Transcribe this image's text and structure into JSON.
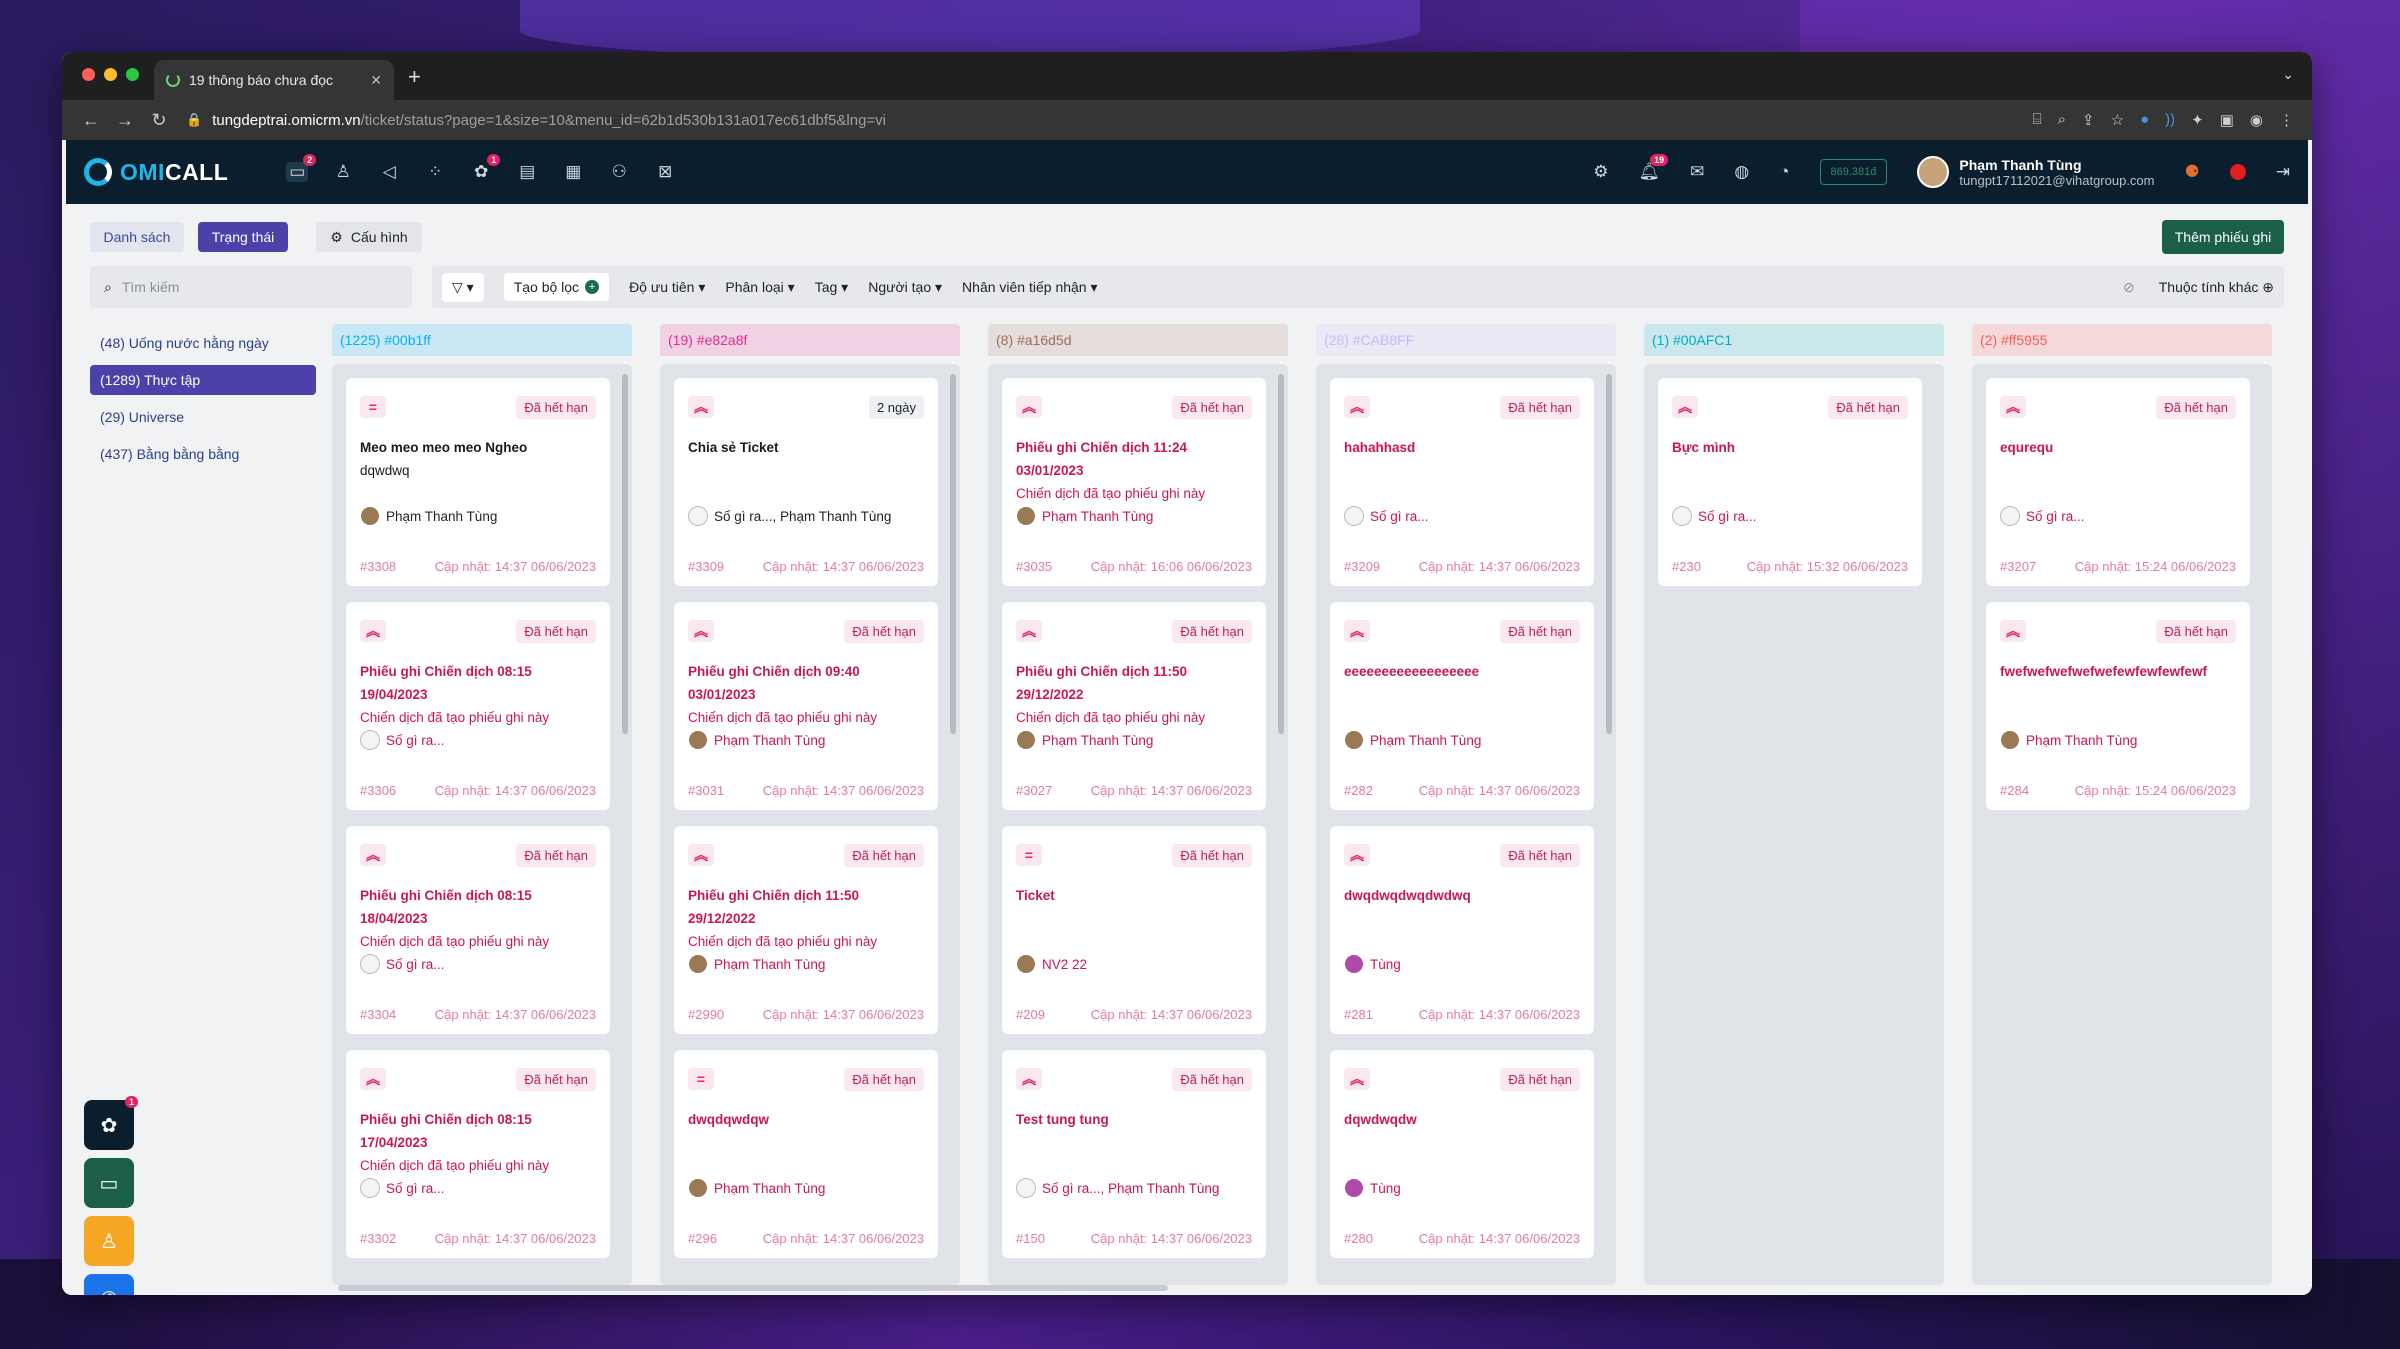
{
  "browser": {
    "tab_title": "19 thông báo chưa đọc",
    "url_host": "tungdeptrai.omicrm.vn",
    "url_path": "/ticket/status?page=1&size=10&menu_id=62b1d530b131a017ec61dbf5&lng=vi"
  },
  "nav": {
    "logo_omi": "OMI",
    "logo_call": "CALL",
    "badge_ticket": "2",
    "badge_support": "1",
    "badge_notify": "19",
    "balance": "869.381đ",
    "user_name": "Phạm Thanh Tùng",
    "user_email": "tungpt17112021@vihatgroup.com"
  },
  "toolbar": {
    "list_label": "Danh sách",
    "status_label": "Trạng thái",
    "config_label": "Cấu hình",
    "add_label": "Thêm phiếu ghi"
  },
  "filters": {
    "search_placeholder": "Tìm kiếm",
    "create_filter": "Tạo bộ lọc",
    "priority": "Độ ưu tiên",
    "category": "Phân loại",
    "tag": "Tag",
    "creator": "Người tạo",
    "assignee": "Nhân viên tiếp nhận",
    "other": "Thuộc tính khác"
  },
  "sidebar": [
    {
      "label": "(48)  Uống nước hằng ngày"
    },
    {
      "label": "(1289)  Thực tập"
    },
    {
      "label": "(29)  Universe"
    },
    {
      "label": "(437)  Bằng bằng bằng"
    }
  ],
  "columns": [
    {
      "head": "(1225) #00b1ff",
      "color": "#00b1ff",
      "cards": [
        {
          "icon": "=",
          "badge": "Đã hết hạn",
          "title": "Meo meo meo meo Ngheo",
          "sub": "dqwdwq",
          "dark": true,
          "assignee": "Phạm Thanh Tùng",
          "id": "#3308",
          "updated": "Cập nhật: 14:37 06/06/2023"
        },
        {
          "icon": "^",
          "badge": "Đã hết hạn",
          "title": "Phiếu ghi Chiến dịch 08:15 19/04/2023",
          "sub": "Chiến dịch đã tạo phiếu ghi này",
          "dark": false,
          "assignee": "Số gì ra...",
          "id": "#3306",
          "updated": "Cập nhật: 14:37 06/06/2023"
        },
        {
          "icon": "^",
          "badge": "Đã hết hạn",
          "title": "Phiếu ghi Chiến dịch 08:15 18/04/2023",
          "sub": "Chiến dịch đã tạo phiếu ghi này",
          "dark": false,
          "assignee": "Số gì ra...",
          "id": "#3304",
          "updated": "Cập nhật: 14:37 06/06/2023"
        },
        {
          "icon": "^",
          "badge": "Đã hết hạn",
          "title": "Phiếu ghi Chiến dịch 08:15 17/04/2023",
          "sub": "Chiến dịch đã tạo phiếu ghi này",
          "dark": false,
          "assignee": "Số gì ra...",
          "id": "#3302",
          "updated": "Cập nhật: 14:37 06/06/2023"
        }
      ]
    },
    {
      "head": "(19) #e82a8f",
      "color": "#e82a8f",
      "cards": [
        {
          "icon": "^",
          "badge": "2 ngày",
          "title": "Chia sẻ Ticket",
          "sub": "",
          "dark": true,
          "assignee": "Số gì ra..., Phạm Thanh Tùng",
          "id": "#3309",
          "updated": "Cập nhật: 14:37 06/06/2023"
        },
        {
          "icon": "^",
          "badge": "Đã hết hạn",
          "title": "Phiếu ghi Chiến dịch 09:40 03/01/2023",
          "sub": "Chiến dịch đã tạo phiếu ghi này",
          "dark": false,
          "assignee": "Phạm Thanh Tùng",
          "id": "#3031",
          "updated": "Cập nhật: 14:37 06/06/2023"
        },
        {
          "icon": "^",
          "badge": "Đã hết hạn",
          "title": "Phiếu ghi Chiến dịch 11:50 29/12/2022",
          "sub": "Chiến dịch đã tạo phiếu ghi này",
          "dark": false,
          "assignee": "Phạm Thanh Tùng",
          "id": "#2990",
          "updated": "Cập nhật: 14:37 06/06/2023"
        },
        {
          "icon": "=",
          "badge": "Đã hết hạn",
          "title": "dwqdqwdqw",
          "sub": "",
          "dark": false,
          "assignee": "Phạm Thanh Tùng",
          "id": "#296",
          "updated": "Cập nhật: 14:37 06/06/2023"
        }
      ]
    },
    {
      "head": "(8) #a16d5d",
      "color": "#a16d5d",
      "cards": [
        {
          "icon": "^",
          "badge": "Đã hết hạn",
          "title": "Phiếu ghi Chiến dịch 11:24 03/01/2023",
          "sub": "Chiến dịch đã tạo phiếu ghi này",
          "dark": false,
          "assignee": "Phạm Thanh Tùng",
          "id": "#3035",
          "updated": "Cập nhật: 16:06 06/06/2023"
        },
        {
          "icon": "^",
          "badge": "Đã hết hạn",
          "title": "Phiếu ghi Chiến dịch 11:50 29/12/2022",
          "sub": "Chiến dịch đã tạo phiếu ghi này",
          "dark": false,
          "assignee": "Phạm Thanh Tùng",
          "id": "#3027",
          "updated": "Cập nhật: 14:37 06/06/2023"
        },
        {
          "icon": "=",
          "badge": "Đã hết hạn",
          "title": "Ticket",
          "sub": "",
          "dark": false,
          "assignee": "NV2 22",
          "id": "#209",
          "updated": "Cập nhật: 14:37 06/06/2023"
        },
        {
          "icon": "^",
          "badge": "Đã hết hạn",
          "title": "Test tung tung",
          "sub": "",
          "dark": false,
          "assignee": "Số gì ra..., Phạm Thanh Tùng",
          "id": "#150",
          "updated": "Cập nhật: 14:37 06/06/2023"
        }
      ]
    },
    {
      "head": "(28) #CAB8FF",
      "color": "#CAB8FF",
      "cards": [
        {
          "icon": "^",
          "badge": "Đã hết hạn",
          "title": "hahahhasd",
          "sub": "",
          "dark": false,
          "assignee": "Số gì ra...",
          "id": "#3209",
          "updated": "Cập nhật: 14:37 06/06/2023"
        },
        {
          "icon": "^",
          "badge": "Đã hết hạn",
          "title": "eeeeeeeeeeeeeeeeee",
          "sub": "",
          "dark": false,
          "assignee": "Phạm Thanh Tùng",
          "id": "#282",
          "updated": "Cập nhật: 14:37 06/06/2023"
        },
        {
          "icon": "^",
          "badge": "Đã hết hạn",
          "title": "dwqdwqdwqdwdwq",
          "sub": "",
          "dark": false,
          "assignee": "Tùng",
          "id": "#281",
          "updated": "Cập nhật: 14:37 06/06/2023"
        },
        {
          "icon": "^",
          "badge": "Đã hết hạn",
          "title": "dqwdwqdw",
          "sub": "",
          "dark": false,
          "assignee": "Tùng",
          "id": "#280",
          "updated": "Cập nhật: 14:37 06/06/2023"
        }
      ]
    },
    {
      "head": "(1) #00AFC1",
      "color": "#00AFC1",
      "cards": [
        {
          "icon": "^",
          "badge": "Đã hết hạn",
          "title": "Bực mình",
          "sub": "",
          "dark": false,
          "assignee": "Số gì ra...",
          "id": "#230",
          "updated": "Cập nhật: 15:32 06/06/2023"
        }
      ]
    },
    {
      "head": "(2) #ff5955",
      "color": "#ff5955",
      "cards": [
        {
          "icon": "^",
          "badge": "Đã hết hạn",
          "title": "equrequ",
          "sub": "",
          "dark": false,
          "assignee": "Số gì ra...",
          "id": "#3207",
          "updated": "Cập nhật: 15:24 06/06/2023"
        },
        {
          "icon": "^",
          "badge": "Đã hết hạn",
          "title": "fwefwefwefwefwefewfewfewfewf",
          "sub": "",
          "dark": false,
          "assignee": "Phạm Thanh Tùng",
          "id": "#284",
          "updated": "Cập nhật: 15:24 06/06/2023"
        }
      ]
    }
  ],
  "dock": {
    "badge": "1"
  }
}
